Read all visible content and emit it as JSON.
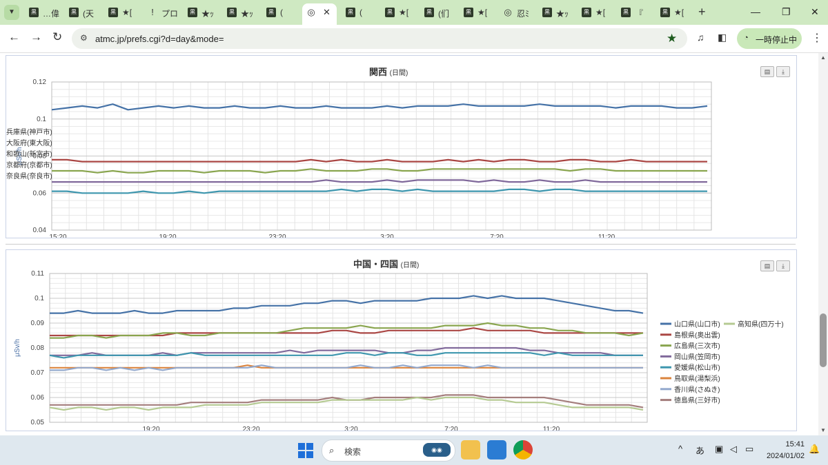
{
  "browser": {
    "tabs": [
      {
        "fav": "黒",
        "label": "…偉",
        "x": 42
      },
      {
        "fav": "黒",
        "label": "(天",
        "x": 100
      },
      {
        "fav": "黒",
        "label": "★[",
        "x": 157
      },
      {
        "fav": "!",
        "label": "プロ",
        "x": 214
      },
      {
        "fav": "黒",
        "label": "★ｯ",
        "x": 272
      },
      {
        "fav": "黒",
        "label": "★ｯ",
        "x": 329
      },
      {
        "fav": "黒",
        "label": "(",
        "x": 386
      },
      {
        "fav": "◎",
        "label": "",
        "x": 444,
        "active": true
      },
      {
        "fav": "黒",
        "label": "(",
        "x": 501
      },
      {
        "fav": "黒",
        "label": "★[",
        "x": 558
      },
      {
        "fav": "黒",
        "label": "(们",
        "x": 615
      },
      {
        "fav": "黒",
        "label": "★[",
        "x": 672
      },
      {
        "fav": "◎",
        "label": "忍ﾐ",
        "x": 729
      },
      {
        "fav": "黒",
        "label": "★ｯ",
        "x": 786
      },
      {
        "fav": "黒",
        "label": "★[",
        "x": 843
      },
      {
        "fav": "黒",
        "label": "『",
        "x": 900
      },
      {
        "fav": "黒",
        "label": "★[",
        "x": 957
      }
    ],
    "url": "atmc.jp/prefs.cgi?d=day&mode=",
    "pause_label": "一時停止中"
  },
  "taskbar": {
    "search_placeholder": "検索",
    "ime": "あ",
    "time": "15:41",
    "date": "2024/01/02"
  },
  "chart_data": [
    {
      "type": "line",
      "title": "関西",
      "subtitle": "(日間)",
      "ylabel": "μSv/h",
      "ylim": [
        0.04,
        0.12
      ],
      "yticks": [
        "0.04",
        "0.06",
        "0.08",
        "0.1",
        "0.12"
      ],
      "xlabels": [
        "15:20",
        "19:20",
        "23:20",
        "3:20",
        "7:20",
        "11:20"
      ],
      "legend": "right",
      "grid": true,
      "series": [
        {
          "name": "兵庫県(神戸市)",
          "color": "#4572a7",
          "values": [
            0.105,
            0.106,
            0.107,
            0.106,
            0.108,
            0.105,
            0.106,
            0.107,
            0.106,
            0.107,
            0.106,
            0.106,
            0.107,
            0.106,
            0.106,
            0.107,
            0.106,
            0.106,
            0.107,
            0.106,
            0.106,
            0.106,
            0.107,
            0.106,
            0.107,
            0.107,
            0.107,
            0.108,
            0.107,
            0.107,
            0.107,
            0.107,
            0.108,
            0.107,
            0.107,
            0.107,
            0.107,
            0.106,
            0.107,
            0.107,
            0.107,
            0.106,
            0.106,
            0.107
          ]
        },
        {
          "name": "大阪府(東大阪)",
          "color": "#aa4643",
          "values": [
            0.078,
            0.078,
            0.077,
            0.077,
            0.077,
            0.077,
            0.077,
            0.077,
            0.077,
            0.077,
            0.077,
            0.077,
            0.077,
            0.077,
            0.077,
            0.077,
            0.077,
            0.078,
            0.077,
            0.078,
            0.077,
            0.077,
            0.078,
            0.077,
            0.077,
            0.077,
            0.078,
            0.077,
            0.078,
            0.077,
            0.078,
            0.078,
            0.077,
            0.077,
            0.078,
            0.078,
            0.077,
            0.077,
            0.078,
            0.077,
            0.077,
            0.077,
            0.077,
            0.077
          ]
        },
        {
          "name": "和歌山(新宮市)",
          "color": "#89a54e",
          "values": [
            0.072,
            0.072,
            0.072,
            0.071,
            0.072,
            0.071,
            0.071,
            0.072,
            0.072,
            0.072,
            0.071,
            0.072,
            0.072,
            0.072,
            0.071,
            0.072,
            0.072,
            0.073,
            0.072,
            0.072,
            0.072,
            0.073,
            0.073,
            0.072,
            0.072,
            0.073,
            0.073,
            0.073,
            0.073,
            0.073,
            0.073,
            0.073,
            0.073,
            0.073,
            0.072,
            0.073,
            0.073,
            0.072,
            0.072,
            0.072,
            0.072,
            0.072,
            0.072,
            0.072
          ]
        },
        {
          "name": "京都府(京都市)",
          "color": "#80699b",
          "values": [
            0.066,
            0.066,
            0.066,
            0.066,
            0.066,
            0.066,
            0.066,
            0.066,
            0.066,
            0.066,
            0.066,
            0.066,
            0.066,
            0.066,
            0.066,
            0.066,
            0.066,
            0.066,
            0.067,
            0.066,
            0.066,
            0.066,
            0.067,
            0.066,
            0.067,
            0.067,
            0.067,
            0.067,
            0.066,
            0.067,
            0.066,
            0.066,
            0.067,
            0.066,
            0.066,
            0.067,
            0.066,
            0.066,
            0.066,
            0.066,
            0.066,
            0.066,
            0.066,
            0.066
          ]
        },
        {
          "name": "奈良県(奈良市)",
          "color": "#3d96ae",
          "values": [
            0.061,
            0.061,
            0.06,
            0.06,
            0.06,
            0.06,
            0.061,
            0.06,
            0.06,
            0.061,
            0.06,
            0.061,
            0.061,
            0.061,
            0.061,
            0.061,
            0.061,
            0.061,
            0.061,
            0.062,
            0.061,
            0.062,
            0.062,
            0.061,
            0.062,
            0.061,
            0.061,
            0.061,
            0.061,
            0.061,
            0.062,
            0.062,
            0.061,
            0.062,
            0.062,
            0.061,
            0.061,
            0.061,
            0.061,
            0.061,
            0.061,
            0.061,
            0.061,
            0.061
          ]
        }
      ]
    },
    {
      "type": "line",
      "title": "中国・四国",
      "subtitle": "(日間)",
      "ylabel": "μSv/h",
      "ylim": [
        0.05,
        0.11
      ],
      "yticks": [
        "0.05",
        "0.06",
        "0.07",
        "0.08",
        "0.09",
        "0.1",
        "0.11"
      ],
      "xlabels": [
        "19:20",
        "23:20",
        "3:20",
        "7:20",
        "11:20"
      ],
      "legend": "right",
      "grid": true,
      "series": [
        {
          "name": "山口県(山口市)",
          "color": "#4572a7",
          "values": [
            0.094,
            0.094,
            0.095,
            0.094,
            0.094,
            0.094,
            0.095,
            0.094,
            0.094,
            0.095,
            0.095,
            0.095,
            0.095,
            0.096,
            0.096,
            0.097,
            0.097,
            0.097,
            0.098,
            0.098,
            0.099,
            0.099,
            0.098,
            0.099,
            0.099,
            0.099,
            0.099,
            0.1,
            0.1,
            0.1,
            0.101,
            0.1,
            0.101,
            0.1,
            0.1,
            0.1,
            0.099,
            0.098,
            0.097,
            0.096,
            0.095,
            0.095,
            0.094
          ]
        },
        {
          "name": "島根県(奥出雲)",
          "color": "#aa4643",
          "values": [
            0.085,
            0.085,
            0.085,
            0.085,
            0.085,
            0.085,
            0.085,
            0.085,
            0.085,
            0.086,
            0.086,
            0.086,
            0.086,
            0.086,
            0.086,
            0.086,
            0.086,
            0.086,
            0.086,
            0.086,
            0.087,
            0.087,
            0.086,
            0.086,
            0.087,
            0.087,
            0.087,
            0.087,
            0.087,
            0.087,
            0.088,
            0.087,
            0.087,
            0.087,
            0.087,
            0.086,
            0.086,
            0.086,
            0.086,
            0.086,
            0.086,
            0.086,
            0.086
          ]
        },
        {
          "name": "広島県(三次市)",
          "color": "#89a54e",
          "values": [
            0.084,
            0.084,
            0.085,
            0.085,
            0.084,
            0.085,
            0.085,
            0.085,
            0.086,
            0.086,
            0.085,
            0.085,
            0.086,
            0.086,
            0.086,
            0.086,
            0.086,
            0.087,
            0.088,
            0.088,
            0.088,
            0.088,
            0.089,
            0.088,
            0.088,
            0.088,
            0.088,
            0.088,
            0.089,
            0.089,
            0.089,
            0.09,
            0.089,
            0.089,
            0.088,
            0.088,
            0.087,
            0.087,
            0.086,
            0.086,
            0.086,
            0.085,
            0.086
          ]
        },
        {
          "name": "岡山県(笠岡市)",
          "color": "#80699b",
          "values": [
            0.077,
            0.077,
            0.077,
            0.078,
            0.077,
            0.077,
            0.077,
            0.077,
            0.078,
            0.077,
            0.078,
            0.078,
            0.078,
            0.078,
            0.078,
            0.078,
            0.078,
            0.079,
            0.078,
            0.079,
            0.079,
            0.079,
            0.079,
            0.079,
            0.078,
            0.078,
            0.079,
            0.079,
            0.08,
            0.08,
            0.08,
            0.08,
            0.08,
            0.08,
            0.079,
            0.079,
            0.078,
            0.078,
            0.078,
            0.078,
            0.077,
            0.077,
            0.077
          ]
        },
        {
          "name": "愛媛県(松山市)",
          "color": "#3d96ae",
          "values": [
            0.077,
            0.076,
            0.077,
            0.077,
            0.077,
            0.077,
            0.077,
            0.077,
            0.077,
            0.077,
            0.078,
            0.077,
            0.077,
            0.077,
            0.077,
            0.077,
            0.077,
            0.077,
            0.077,
            0.077,
            0.077,
            0.078,
            0.078,
            0.077,
            0.078,
            0.078,
            0.077,
            0.077,
            0.078,
            0.078,
            0.078,
            0.078,
            0.078,
            0.078,
            0.078,
            0.077,
            0.078,
            0.077,
            0.077,
            0.077,
            0.077,
            0.077,
            0.077
          ]
        },
        {
          "name": "鳥取県(湯梨浜)",
          "color": "#db843d",
          "values": [
            0.072,
            0.072,
            0.072,
            0.072,
            0.072,
            0.072,
            0.072,
            0.072,
            0.072,
            0.072,
            0.072,
            0.072,
            0.072,
            0.072,
            0.073,
            0.072,
            0.072,
            0.072,
            0.072,
            0.072,
            0.072,
            0.072,
            0.072,
            0.072,
            0.072,
            0.072,
            0.072,
            0.072,
            0.072,
            0.072,
            0.072,
            0.072,
            0.072,
            0.072,
            0.072,
            0.072,
            0.072,
            0.072,
            0.072,
            0.072,
            0.072,
            0.072,
            0.072
          ]
        },
        {
          "name": "香川県(さぬき)",
          "color": "#92a8cd",
          "values": [
            0.071,
            0.071,
            0.072,
            0.072,
            0.071,
            0.072,
            0.071,
            0.072,
            0.071,
            0.072,
            0.072,
            0.072,
            0.072,
            0.072,
            0.072,
            0.073,
            0.072,
            0.072,
            0.072,
            0.072,
            0.072,
            0.072,
            0.073,
            0.072,
            0.072,
            0.073,
            0.072,
            0.073,
            0.073,
            0.073,
            0.072,
            0.073,
            0.072,
            0.072,
            0.072,
            0.072,
            0.072,
            0.072,
            0.072,
            0.072,
            0.072,
            0.072,
            0.072
          ]
        },
        {
          "name": "徳島県(三好市)",
          "color": "#a47d7c",
          "values": [
            0.057,
            0.057,
            0.057,
            0.057,
            0.057,
            0.057,
            0.057,
            0.057,
            0.057,
            0.057,
            0.058,
            0.058,
            0.058,
            0.058,
            0.058,
            0.059,
            0.059,
            0.059,
            0.059,
            0.059,
            0.06,
            0.059,
            0.059,
            0.06,
            0.06,
            0.06,
            0.06,
            0.06,
            0.061,
            0.061,
            0.061,
            0.06,
            0.06,
            0.06,
            0.06,
            0.06,
            0.059,
            0.058,
            0.057,
            0.057,
            0.057,
            0.057,
            0.056
          ]
        },
        {
          "name": "高知県(四万十)",
          "color": "#b5ca92",
          "values": [
            0.056,
            0.055,
            0.056,
            0.056,
            0.055,
            0.056,
            0.056,
            0.055,
            0.056,
            0.056,
            0.056,
            0.057,
            0.057,
            0.057,
            0.057,
            0.058,
            0.058,
            0.058,
            0.058,
            0.058,
            0.059,
            0.059,
            0.059,
            0.059,
            0.059,
            0.059,
            0.06,
            0.059,
            0.06,
            0.06,
            0.06,
            0.059,
            0.059,
            0.058,
            0.058,
            0.058,
            0.057,
            0.056,
            0.056,
            0.056,
            0.056,
            0.056,
            0.055
          ]
        }
      ]
    }
  ]
}
